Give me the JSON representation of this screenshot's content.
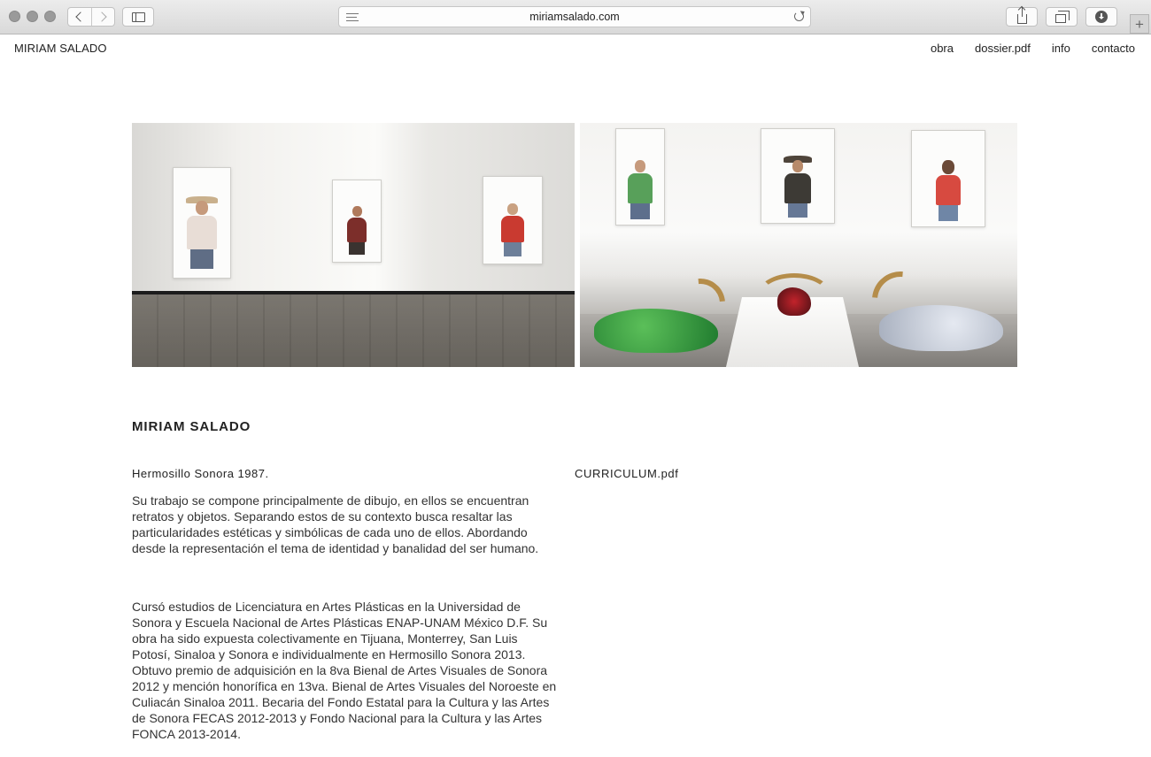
{
  "browser": {
    "url": "miriamsalado.com",
    "icons": {
      "back": "chevron-left-icon",
      "forward": "chevron-right-icon",
      "sidebar": "sidebar-icon",
      "reader": "reader-icon",
      "reload": "reload-icon",
      "share": "share-icon",
      "tabs": "tabs-overview-icon",
      "downloads": "download-icon",
      "new_tab": "plus-icon"
    },
    "new_tab_label": "+"
  },
  "site": {
    "title": "MIRIAM SALADO",
    "nav": [
      {
        "label": "obra"
      },
      {
        "label": "dossier.pdf"
      },
      {
        "label": "info"
      },
      {
        "label": "contacto"
      }
    ]
  },
  "gallery": {
    "images": [
      {
        "subject": "gallery-room-portrait-drawings"
      },
      {
        "subject": "gallery-portraits-and-decorated-skulls"
      }
    ]
  },
  "content": {
    "heading": "MIRIAM SALADO",
    "birth_line": "Hermosillo Sonora 1987.",
    "cv_link": "CURRICULUM.pdf",
    "paragraph_1": "Su trabajo se compone principalmente de dibujo, en ellos se encuentran retratos y objetos. Separando estos de su contexto busca resaltar las particularidades estéticas y simbólicas de cada uno de ellos. Abordando desde la representación el tema de identidad y banalidad del ser humano.",
    "paragraph_2": "Cursó estudios de Licenciatura en Artes Plásticas en la Universidad de Sonora y Escuela Nacional de Artes Plásticas ENAP-UNAM México D.F. Su obra ha sido expuesta colectivamente en Tijuana, Monterrey, San Luis Potosí, Sinaloa y Sonora e individualmente en Hermosillo Sonora 2013. Obtuvo premio de adquisición en la 8va Bienal de Artes Visuales de Sonora 2012 y mención honorífica en 13va. Bienal de Artes Visuales del Noroeste en Culiacán Sinaloa 2011. Becaria del Fondo Estatal para la Cultura y las Artes de Sonora FECAS 2012-2013 y Fondo Nacional para la Cultura y las Artes FONCA 2013-2014."
  }
}
